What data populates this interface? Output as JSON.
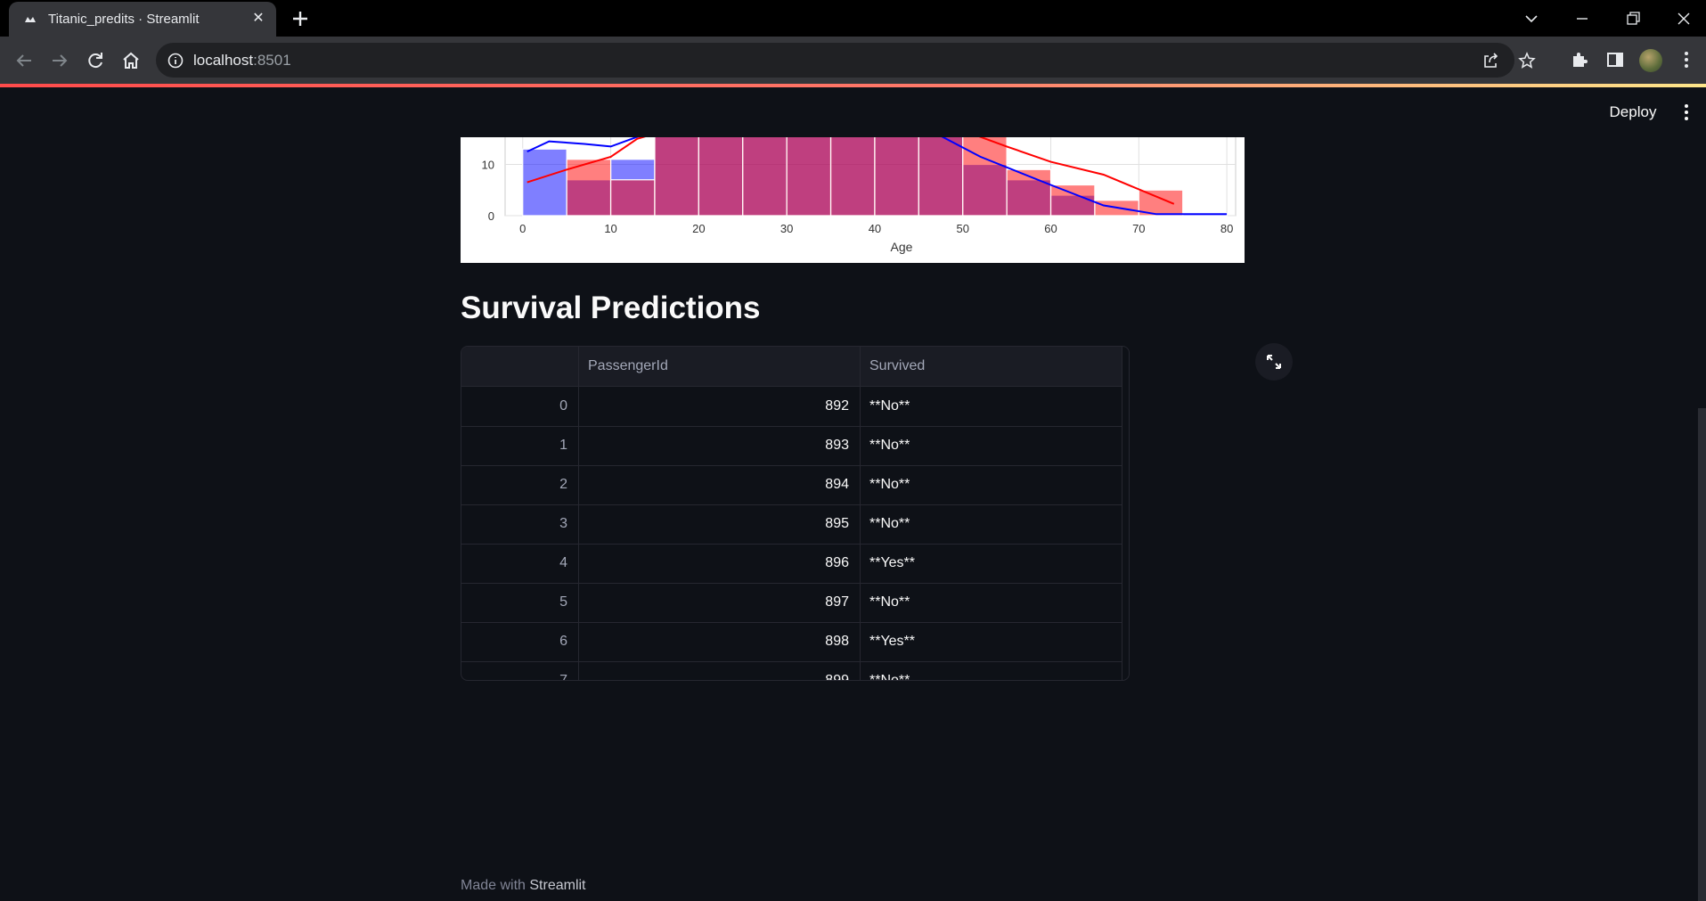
{
  "browser": {
    "tab_title": "Titanic_predits · Streamlit",
    "url_host": "localhost",
    "url_port": ":8501"
  },
  "header": {
    "deploy_label": "Deploy"
  },
  "chart_data": {
    "type": "bar",
    "xlabel": "Age",
    "ylabel": "",
    "x_ticks": [
      "0",
      "10",
      "20",
      "30",
      "40",
      "50",
      "60",
      "70",
      "80"
    ],
    "y_ticks_visible": [
      "0",
      "10"
    ],
    "xlim": [
      -2,
      81
    ],
    "ylim_visible": [
      0,
      16
    ],
    "bin_edges": [
      0,
      5,
      10,
      15,
      20,
      25,
      30,
      35,
      40,
      45,
      50,
      55,
      60,
      65,
      70,
      75,
      80
    ],
    "series": [
      {
        "color": "#0000ff",
        "values": [
          13,
          7,
          11,
          16,
          16,
          16,
          16,
          16,
          16,
          16,
          10,
          7,
          4,
          0,
          0,
          0.5
        ],
        "kde": [
          [
            0.5,
            12.5
          ],
          [
            3,
            14.5
          ],
          [
            7,
            14
          ],
          [
            10,
            13.5
          ],
          [
            14,
            16
          ],
          [
            47,
            16
          ],
          [
            52,
            11.5
          ],
          [
            60,
            6
          ],
          [
            66,
            2
          ],
          [
            72,
            0.3
          ],
          [
            80,
            0.3
          ]
        ]
      },
      {
        "color": "#ff0000",
        "values": [
          0,
          11,
          7,
          16,
          16,
          16,
          16,
          16,
          16,
          16,
          16,
          9,
          6,
          3,
          5,
          0
        ],
        "kde": [
          [
            0.5,
            6.5
          ],
          [
            5,
            9
          ],
          [
            10,
            11.5
          ],
          [
            13,
            15
          ],
          [
            15,
            16
          ],
          [
            51,
            16
          ],
          [
            55,
            13.5
          ],
          [
            60,
            10.5
          ],
          [
            66,
            8
          ],
          [
            74,
            2.3
          ]
        ]
      }
    ]
  },
  "main": {
    "heading": "Survival Predictions"
  },
  "table": {
    "columns": [
      "",
      "PassengerId",
      "Survived"
    ],
    "rows": [
      [
        "0",
        "892",
        "**No**"
      ],
      [
        "1",
        "893",
        "**No**"
      ],
      [
        "2",
        "894",
        "**No**"
      ],
      [
        "3",
        "895",
        "**No**"
      ],
      [
        "4",
        "896",
        "**Yes**"
      ],
      [
        "5",
        "897",
        "**No**"
      ],
      [
        "6",
        "898",
        "**Yes**"
      ],
      [
        "7",
        "899",
        "**No**"
      ]
    ]
  },
  "footer": {
    "made_with": "Made with",
    "brand": "Streamlit"
  }
}
